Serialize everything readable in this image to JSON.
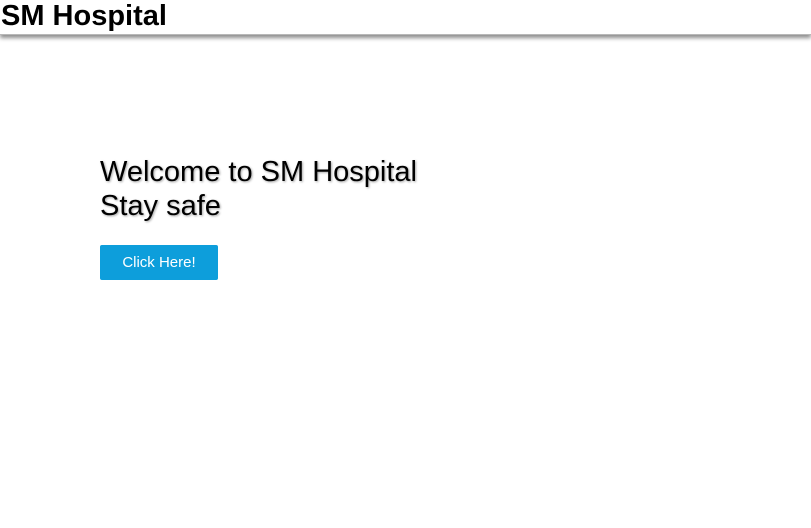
{
  "header": {
    "brand_title": "SM Hospital"
  },
  "hero": {
    "welcome_line": "Welcome to SM Hospital",
    "tagline": "Stay safe",
    "button_label": "Click Here!"
  },
  "colors": {
    "button_background": "#0d9edb",
    "button_text": "#ffffff",
    "page_background": "#ffffff"
  }
}
